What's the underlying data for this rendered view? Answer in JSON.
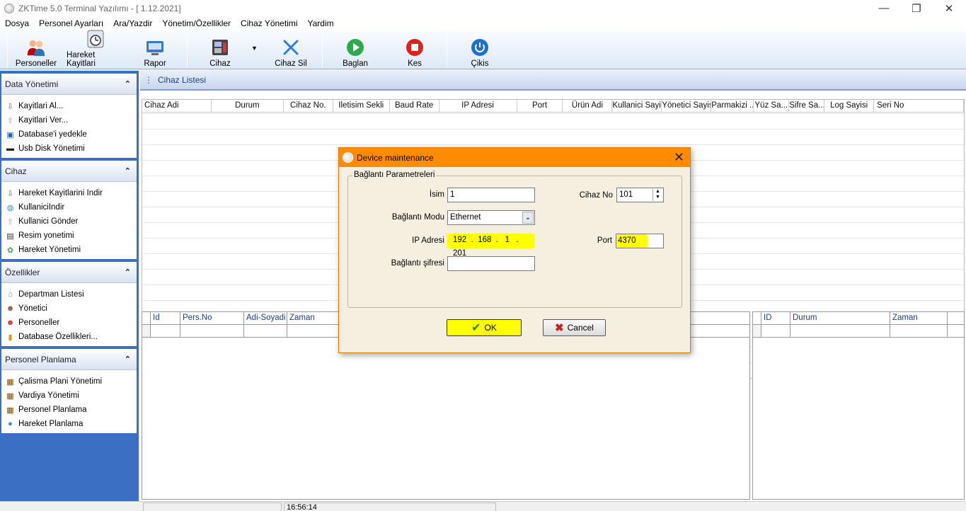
{
  "window": {
    "title": "ZKTime 5.0 Terminal Yazılımı - [  1.12.2021]",
    "minimize": "—",
    "restore": "❐",
    "close": "✕"
  },
  "menu": [
    "Dosya",
    "Personel Ayarları",
    "Ara/Yazdir",
    "Yönetim/Özellikler",
    "Cihaz Yönetimi",
    "Yardim"
  ],
  "toolbar": {
    "personeller": "Personeller",
    "hareket": "Hareket Kayitlari",
    "rapor": "Rapor",
    "cihaz": "Cihaz",
    "cihaz_sil": "Cihaz Sil",
    "baglan": "Baglan",
    "kes": "Kes",
    "cikis": "Çikis"
  },
  "sidebar": {
    "sections": [
      {
        "title": "Data Yönetimi",
        "items": [
          "Kayitlari Al...",
          "Kayitlari Ver...",
          "Database'i yedekle",
          "Usb Disk Yönetimi"
        ]
      },
      {
        "title": "Cihaz",
        "items": [
          "Hareket Kayitlarini Indir",
          "KullaniciIndir",
          "Kullanici Gönder",
          "Resim yonetimi",
          "Hareket Yönetimi"
        ]
      },
      {
        "title": "Özellikler",
        "items": [
          "Departman Listesi",
          "Yönetici",
          "Personeller",
          "Database Özellikleri..."
        ]
      },
      {
        "title": "Personel Planlama",
        "items": [
          "Çalisma Plani Yönetimi",
          "Vardiya Yönetimi",
          "Personel Planlama",
          "Hareket Planlama"
        ]
      }
    ]
  },
  "main": {
    "title": "Cihaz Listesi",
    "columns": [
      "Cihaz Adi",
      "Durum",
      "Cihaz No.",
      "Iletisim Sekli",
      "Baud Rate",
      "IP Adresi",
      "Port",
      "Ürün Adi",
      "Kullanici Sayisi",
      "Yönetici Sayisi",
      "Parmakizi ...",
      "Yüz Sa...",
      "Sifre Sa...",
      "Log Sayisi",
      "Seri No"
    ],
    "bottom_left_columns": [
      "Id",
      "Pers.No",
      "Adi-Soyadi",
      "Zaman"
    ],
    "bottom_right_columns": [
      "ID",
      "Durum",
      "Zaman"
    ]
  },
  "status": {
    "time": "16:56:14"
  },
  "dialog": {
    "title": "Device maintenance",
    "group": "Bağlantı Parametreleri",
    "isim_label": "İsim",
    "isim_value": "1",
    "cihaz_no_label": "Cihaz No",
    "cihaz_no_value": "101",
    "baglanti_modu_label": "Bağlantı Modu",
    "baglanti_modu_value": "Ethernet",
    "ip_label": "IP Adresi",
    "ip": [
      "192",
      "168",
      "1",
      "201"
    ],
    "port_label": "Port",
    "port_value": "4370",
    "sifre_label": "Bağlantı şifresi",
    "sifre_value": "",
    "ok": "OK",
    "cancel": "Cancel"
  },
  "colors": {
    "accent_orange": "#ff8c00",
    "highlight": "#ffff00",
    "sidebar_blue": "#3a6fc4"
  }
}
